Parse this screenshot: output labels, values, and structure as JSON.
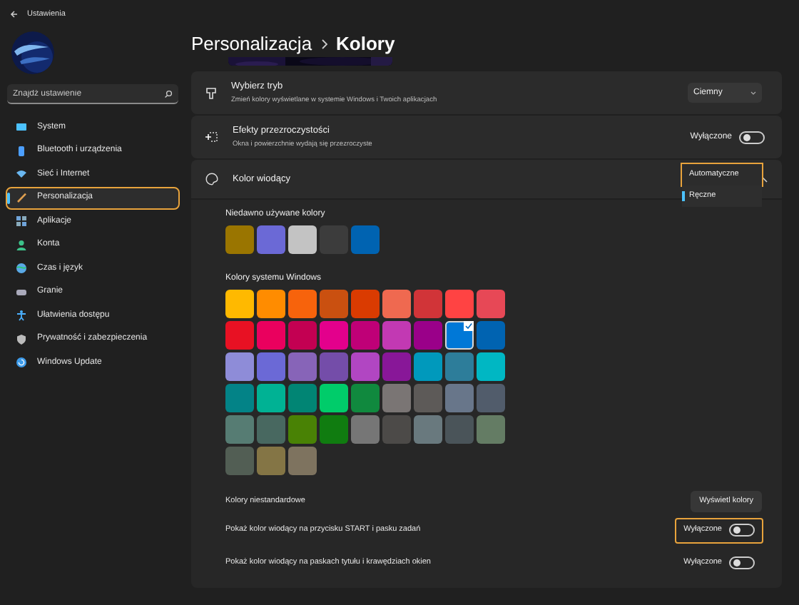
{
  "window": {
    "title": "Ustawienia"
  },
  "sidebar": {
    "search": {
      "placeholder": "Znajdź ustawienie"
    },
    "items": [
      {
        "label": "System",
        "selected": false,
        "highlighted": false
      },
      {
        "label": "Bluetooth i urządzenia",
        "selected": false,
        "highlighted": false
      },
      {
        "label": "Sieć i Internet",
        "selected": false,
        "highlighted": false
      },
      {
        "label": "Personalizacja",
        "selected": true,
        "highlighted": true
      },
      {
        "label": "Aplikacje",
        "selected": false,
        "highlighted": false
      },
      {
        "label": "Konta",
        "selected": false,
        "highlighted": false
      },
      {
        "label": "Czas i język",
        "selected": false,
        "highlighted": false
      },
      {
        "label": "Granie",
        "selected": false,
        "highlighted": false
      },
      {
        "label": "Ułatwienia dostępu",
        "selected": false,
        "highlighted": false
      },
      {
        "label": "Prywatność i zabezpieczenia",
        "selected": false,
        "highlighted": false
      },
      {
        "label": "Windows Update",
        "selected": false,
        "highlighted": false
      }
    ]
  },
  "breadcrumb": [
    "Personalizacja",
    "Kolory"
  ],
  "cards": [
    {
      "kind": "dropdown",
      "title": "Wybierz tryb",
      "description": "Zmień kolory wyświetlane w systemie Windows i Twoich aplikacjach",
      "value": "Ciemny"
    },
    {
      "kind": "toggle",
      "title": "Efekty przezroczystości",
      "description": "Okna i powierzchnie wydają się przezroczyste",
      "state_label": "Wyłączone",
      "on": false
    },
    {
      "kind": "expander",
      "title": "Kolor wiodący",
      "expanded": true
    }
  ],
  "accent_menu": {
    "options": [
      {
        "label": "Automatyczne",
        "selected": false,
        "highlighted": true
      },
      {
        "label": "Ręczne",
        "selected": true,
        "highlighted": false
      }
    ]
  },
  "recent_colors": {
    "label": "Niedawno używane kolory",
    "swatches": [
      {
        "color": "#9a7500"
      },
      {
        "color": "#6b69d6"
      },
      {
        "color": "#c3c3c3"
      },
      {
        "color": "#3c3c3c"
      },
      {
        "color": "#0063b1"
      }
    ]
  },
  "windows_colors": {
    "label": "Kolory systemu Windows",
    "swatches": [
      {
        "color": "#ffb900",
        "selected": false
      },
      {
        "color": "#ff8c00",
        "selected": false
      },
      {
        "color": "#f7630c",
        "selected": false
      },
      {
        "color": "#ca5010",
        "selected": false
      },
      {
        "color": "#da3b01",
        "selected": false
      },
      {
        "color": "#ef6950",
        "selected": false
      },
      {
        "color": "#d13438",
        "selected": false
      },
      {
        "color": "#ff4343",
        "selected": false
      },
      {
        "color": "#e74856",
        "selected": false
      },
      {
        "color": "#e81123",
        "selected": false
      },
      {
        "color": "#ea005e",
        "selected": false
      },
      {
        "color": "#c30052",
        "selected": false
      },
      {
        "color": "#e3008c",
        "selected": false
      },
      {
        "color": "#bf0077",
        "selected": false
      },
      {
        "color": "#c239b3",
        "selected": false
      },
      {
        "color": "#9a0089",
        "selected": false
      },
      {
        "color": "#0078d7",
        "selected": true
      },
      {
        "color": "#0063b1",
        "selected": false
      },
      {
        "color": "#8e8cd8",
        "selected": false
      },
      {
        "color": "#6b69d6",
        "selected": false
      },
      {
        "color": "#8764b8",
        "selected": false
      },
      {
        "color": "#744da9",
        "selected": false
      },
      {
        "color": "#b146c2",
        "selected": false
      },
      {
        "color": "#881798",
        "selected": false
      },
      {
        "color": "#0099bc",
        "selected": false
      },
      {
        "color": "#2d7d9a",
        "selected": false
      },
      {
        "color": "#00b7c3",
        "selected": false
      },
      {
        "color": "#038387",
        "selected": false
      },
      {
        "color": "#00b294",
        "selected": false
      },
      {
        "color": "#018574",
        "selected": false
      },
      {
        "color": "#00cc6a",
        "selected": false
      },
      {
        "color": "#10893e",
        "selected": false
      },
      {
        "color": "#7a7574",
        "selected": false
      },
      {
        "color": "#5d5a58",
        "selected": false
      },
      {
        "color": "#68768a",
        "selected": false
      },
      {
        "color": "#515c6b",
        "selected": false
      },
      {
        "color": "#567c73",
        "selected": false
      },
      {
        "color": "#486860",
        "selected": false
      },
      {
        "color": "#498205",
        "selected": false
      },
      {
        "color": "#107c10",
        "selected": false
      },
      {
        "color": "#767676",
        "selected": false
      },
      {
        "color": "#4c4a48",
        "selected": false
      },
      {
        "color": "#69797e",
        "selected": false
      },
      {
        "color": "#4a5459",
        "selected": false
      },
      {
        "color": "#647c64",
        "selected": false
      },
      {
        "color": "#525e54",
        "selected": false
      },
      {
        "color": "#847545",
        "selected": false
      },
      {
        "color": "#7e735f",
        "selected": false
      }
    ]
  },
  "custom_colors": {
    "label": "Kolory niestandardowe",
    "button": "Wyświetl kolory"
  },
  "accent_toggles": [
    {
      "label": "Pokaż kolor wiodący na przycisku START i pasku zadań",
      "state_label": "Wyłączone",
      "on": false,
      "highlighted": true
    },
    {
      "label": "Pokaż kolor wiodący na paskach tytułu i krawędziach okien",
      "state_label": "Wyłączone",
      "on": false,
      "highlighted": false
    }
  ]
}
